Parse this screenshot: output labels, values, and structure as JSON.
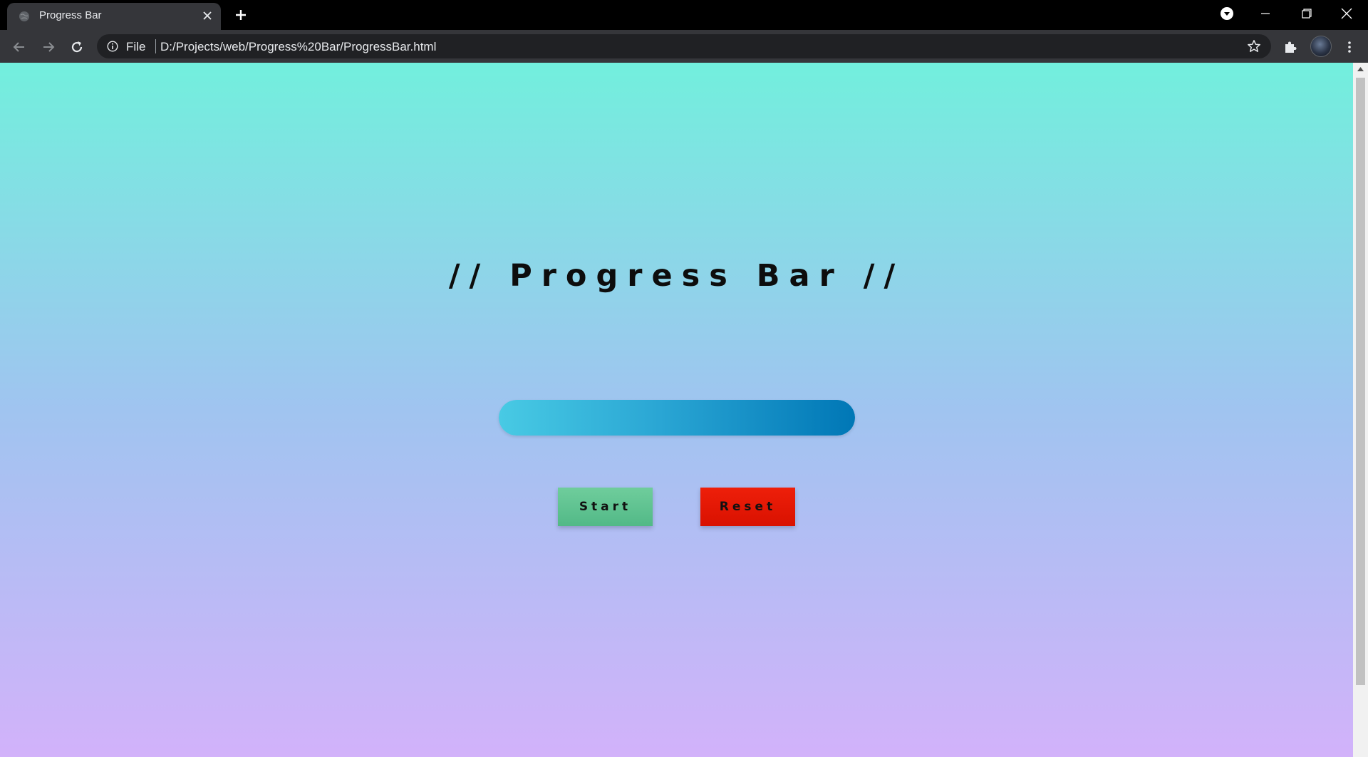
{
  "browser": {
    "tab_title": "Progress Bar",
    "omnibox_scheme": "File",
    "url": "D:/Projects/web/Progress%20Bar/ProgressBar.html"
  },
  "page": {
    "title": "// Progress Bar //",
    "progress_percent": 100,
    "start_label": "Start",
    "reset_label": "Reset"
  },
  "colors": {
    "bg_top": "#72efdd",
    "bg_bottom": "#d2b2fa",
    "bar_start": "#48cae4",
    "bar_end": "#0077b6",
    "start_button": "#5ec393",
    "reset_button": "#e31500"
  },
  "icons": {
    "tab": [
      "globe-icon",
      "close-icon",
      "plus-icon"
    ],
    "window": [
      "media-control-icon",
      "minimize-icon",
      "restore-icon",
      "close-icon"
    ],
    "toolbar": [
      "back-arrow-icon",
      "forward-arrow-icon",
      "reload-icon",
      "info-icon",
      "star-icon",
      "puzzle-icon",
      "kebab-menu-icon"
    ]
  }
}
